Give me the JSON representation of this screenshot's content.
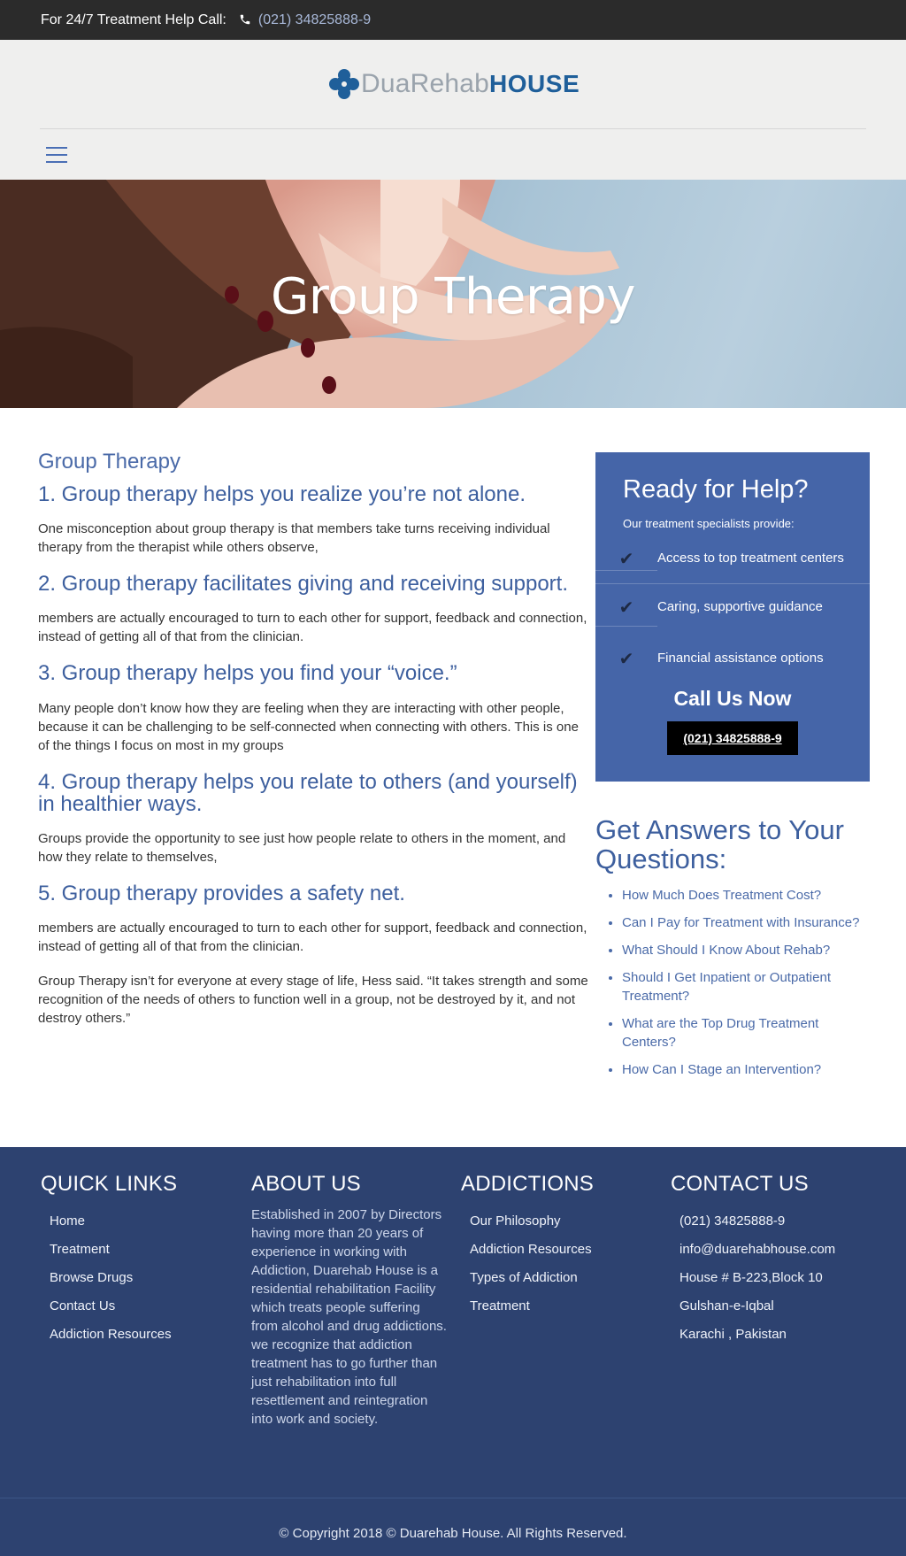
{
  "topbar": {
    "label": "For 24/7 Treatment Help Call:",
    "phone": "(021) 34825888-9",
    "phone_icon": "phone-icon"
  },
  "logo": {
    "text_light": "DuaRehab",
    "text_bold": "HOUSE",
    "icon": "cross-logo-icon",
    "colors": {
      "mark": "#1f5f9a",
      "light": "#9aa3ac"
    }
  },
  "nav": {
    "menu_icon": "hamburger-menu-icon"
  },
  "hero": {
    "title": "Group Therapy"
  },
  "main": {
    "category": "Group Therapy",
    "sections": [
      {
        "heading": "1. Group therapy helps you realize you’re not alone.",
        "body": "One misconception about group therapy is that members take turns receiving individual therapy from the therapist while others observe,"
      },
      {
        "heading": "2. Group therapy facilitates giving and receiving support.",
        "body": "members are actually encouraged to turn to each other for support, feedback and connection, instead of getting all of that from the clinician."
      },
      {
        "heading": "3. Group therapy helps you find your “voice.”",
        "body": "Many people don’t know how they are feeling when they are interacting with other people, because it can be challenging to be self-connected when connecting with others. This is one of the things I focus on most in my groups"
      },
      {
        "heading": "4. Group therapy helps you relate to others (and yourself) in healthier ways.",
        "body": "Groups provide the opportunity to see just how people relate to others in the moment, and how they relate to themselves,"
      },
      {
        "heading": "5. Group therapy provides a safety net.",
        "body": "members are actually encouraged to turn to each other for support, feedback and connection, instead of getting all of that from the clinician."
      }
    ],
    "closing": "Group Therapy isn’t for everyone at every stage of life, Hess said. “It takes strength and some recognition of the needs of others to function well in a group, not be destroyed by it, and not destroy others.”"
  },
  "help": {
    "title": "Ready for Help?",
    "subtitle": "Our treatment specialists provide:",
    "items": [
      "Access to top treatment centers",
      "Caring, supportive guidance",
      "Financial assistance options"
    ],
    "check_icon": "checkmark-icon",
    "call_label": "Call Us Now",
    "call_button": "(021) 34825888-9",
    "colors": {
      "panel": "#4565a8",
      "button": "#000000"
    }
  },
  "answers": {
    "title": "Get Answers to Your Questions:",
    "links": [
      "How Much Does Treatment Cost?",
      "Can I Pay for Treatment with Insurance?",
      "What Should I Know About Rehab?",
      "Should I Get Inpatient or Outpatient Treatment?",
      "What are the Top Drug Treatment Centers?",
      "How Can I Stage an Intervention?"
    ]
  },
  "footer": {
    "quick_links": {
      "title": "QUICK LINKS",
      "items": [
        "Home",
        "Treatment",
        "Browse Drugs",
        "Contact Us",
        "Addiction Resources"
      ]
    },
    "about": {
      "title": "ABOUT US",
      "text": "Established in 2007 by Directors having more than 20 years of experience in working with Addiction, Duarehab House is a residential rehabilitation Facility which treats people suffering from alcohol and drug addictions. we recognize that addiction treatment has to go further than just rehabilitation into full resettlement and reintegration into work and society."
    },
    "addictions": {
      "title": "ADDICTIONS",
      "items": [
        "Our Philosophy",
        "Addiction Resources",
        "Types of Addiction",
        "Treatment"
      ]
    },
    "contact": {
      "title": "CONTACT US",
      "items": [
        "(021) 34825888-9",
        "info@duarehabhouse.com",
        "House # B-223,Block 10",
        "Gulshan-e-Iqbal",
        "Karachi , Pakistan"
      ]
    },
    "copyright": "© Copyright 2018 © Duarehab House. All Rights Reserved.",
    "colors": {
      "background": "#2d4270"
    }
  }
}
